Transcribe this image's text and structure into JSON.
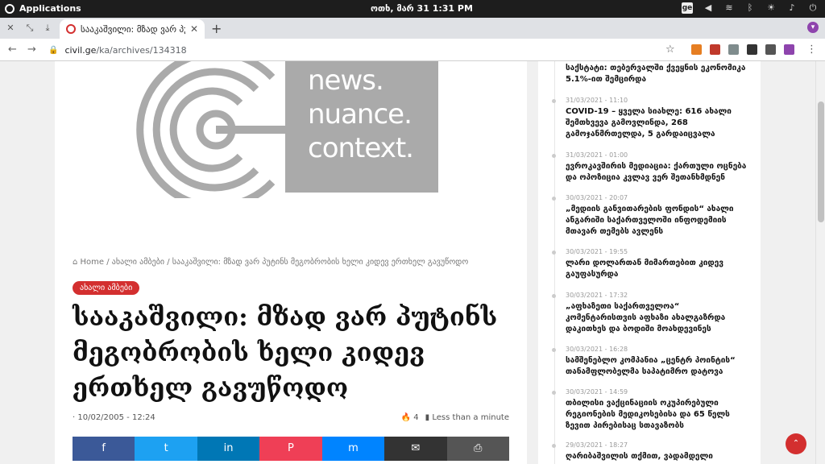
{
  "system": {
    "apps_label": "Applications",
    "clock": "ოთხ, მარ 31   1:31 PM",
    "ge_badge": "ge"
  },
  "browser": {
    "tab_title": "სააკაშვილი: მზად ვარ პუტინს",
    "url_domain": "civil.ge",
    "url_path": "/ka/archives/134318"
  },
  "article": {
    "logo_lines": [
      "news.",
      "nuance.",
      "context."
    ],
    "breadcrumb": "⌂ Home / ახალი ამბები / სააკაშვილი: მზად ვარ პუტინს მეგობრობის ხელი კიდევ ერთხელ გავუწოდო",
    "category": "ახალი ამბები",
    "title": "სააკაშვილი: მზად ვარ პუტინს მეგობრობის ხელი კიდევ ერთხელ გავუწოდო",
    "date": "10/02/2005 - 12:24",
    "views": "4",
    "read_time": "Less than a minute"
  },
  "share": {
    "facebook": "f",
    "twitter": "t",
    "linkedin": "in",
    "pocket": "P",
    "messenger": "m",
    "email": "✉",
    "print": "⎙"
  },
  "sidebar": {
    "items": [
      {
        "date": "",
        "headline": "საქსტატი: თებერვალში ქვეყნის ეკონომიკა 5.1%-ით შემცირდა"
      },
      {
        "date": "31/03/2021 - 11:10",
        "headline": "COVID-19 – ყველა სიახლე: 616 ახალი შემთხვევა გამოვლინდა, 268 გამოჯანმრთელდა, 5 გარდაიცვალა"
      },
      {
        "date": "31/03/2021 - 01:00",
        "headline": "ევროკავშირის მედიაცია: ქართული ოცნება და ოპოზიცია კვლავ ვერ შეთანხმდნენ"
      },
      {
        "date": "30/03/2021 - 20:07",
        "headline": "„მედიის განვითარების ფონდის“ ახალი ანგარიში საქართველოში ინფოდემიის მთავარ თემებს ავლენს"
      },
      {
        "date": "30/03/2021 - 19:55",
        "headline": "ლარი დოლართან მიმართებით კიდევ გაუფასურდა"
      },
      {
        "date": "30/03/2021 - 17:32",
        "headline": "„აფხაზეთი საქართველოა“ კომენტარისთვის აფხაზი ახალგაზრდა დაკითხეს და ბოდიში მოახდევინეს"
      },
      {
        "date": "30/03/2021 - 16:28",
        "headline": "სამშენებლო კომპანია „ცენტრ პოინტის“ თანამფლობელმა საპატიმრო დატოვა"
      },
      {
        "date": "30/03/2021 - 14:59",
        "headline": "თბილისი ვაქცინაციის ოკუპირებული რეგიონების მედიკოსებისა და 65 წელს ზევით პირებისაც სთავაზობს"
      },
      {
        "date": "29/03/2021 - 18:27",
        "headline": "ღარიბაშვილის თქმით, ვადამდელი"
      }
    ]
  },
  "colors": {
    "accent": "#d32f2f",
    "facebook": "#3b5998",
    "twitter": "#1da1f2",
    "linkedin": "#0077b5",
    "pocket": "#ef3f56",
    "messenger": "#0084ff",
    "email": "#333333",
    "print": "#555555"
  }
}
